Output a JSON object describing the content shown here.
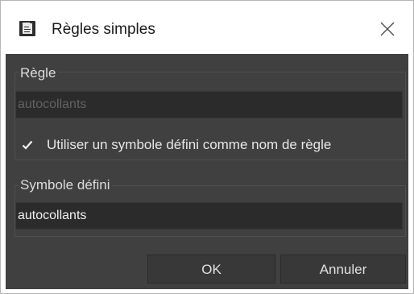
{
  "window": {
    "title": "Règles simples",
    "icon": "rules-document-icon",
    "close_icon": "close-icon"
  },
  "rule_group": {
    "label": "Règle",
    "input_value": "autocollants",
    "input_enabled": false,
    "checkbox": {
      "label": "Utiliser un symbole défini comme nom de règle",
      "checked": true
    }
  },
  "symbol_group": {
    "label": "Symbole défini",
    "input_value": "autocollants",
    "input_enabled": true
  },
  "buttons": {
    "ok_label": "OK",
    "cancel_label": "Annuler"
  },
  "colors": {
    "dialog_background": "#404040",
    "field_background": "#2b2b2b",
    "titlebar_background": "#ffffff"
  }
}
